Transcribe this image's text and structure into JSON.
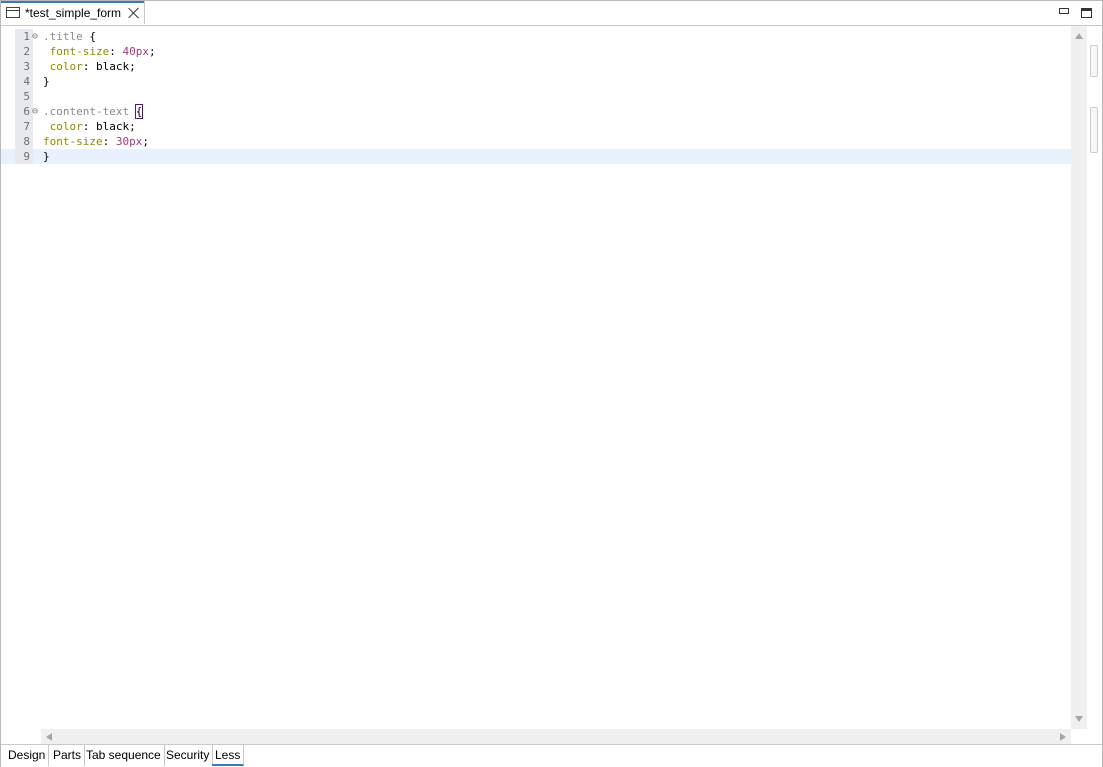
{
  "editor_tab": {
    "title": "*test_simple_form"
  },
  "window_controls": [
    "minimize",
    "maximize"
  ],
  "code": {
    "lines": [
      {
        "n": "1",
        "fold": "⊖",
        "tokens": [
          {
            "t": ".title",
            "c": "sel"
          },
          {
            "t": " {",
            "c": "plain"
          }
        ]
      },
      {
        "n": "2",
        "fold": "",
        "tokens": [
          {
            "t": " font-size",
            "c": "prop"
          },
          {
            "t": ": ",
            "c": "plain"
          },
          {
            "t": "40px",
            "c": "num"
          },
          {
            "t": ";",
            "c": "plain"
          }
        ]
      },
      {
        "n": "3",
        "fold": "",
        "tokens": [
          {
            "t": " color",
            "c": "prop"
          },
          {
            "t": ": black;",
            "c": "plain"
          }
        ]
      },
      {
        "n": "4",
        "fold": "",
        "tokens": [
          {
            "t": "}",
            "c": "plain"
          }
        ]
      },
      {
        "n": "5",
        "fold": "",
        "tokens": []
      },
      {
        "n": "6",
        "fold": "⊖",
        "tokens": [
          {
            "t": ".content-text",
            "c": "sel"
          },
          {
            "t": " ",
            "c": "plain"
          },
          {
            "t": "{",
            "c": "plain",
            "box": true
          }
        ]
      },
      {
        "n": "7",
        "fold": "",
        "tokens": [
          {
            "t": " color",
            "c": "prop"
          },
          {
            "t": ": black;",
            "c": "plain"
          }
        ]
      },
      {
        "n": "8",
        "fold": "",
        "tokens": [
          {
            "t": "font-size",
            "c": "prop"
          },
          {
            "t": ": ",
            "c": "plain"
          },
          {
            "t": "30px",
            "c": "num"
          },
          {
            "t": ";",
            "c": "plain"
          }
        ]
      },
      {
        "n": "9",
        "fold": "",
        "tokens": [
          {
            "t": "}",
            "c": "plain"
          }
        ],
        "current": true
      }
    ]
  },
  "page_tabs": {
    "items": [
      {
        "label": "Design"
      },
      {
        "label": "Parts"
      },
      {
        "label": "Tab sequence"
      },
      {
        "label": "Security"
      },
      {
        "label": "Less",
        "active": true
      }
    ]
  },
  "colors": {
    "accent": "#3b78c0",
    "current_line": "#e8f2fe",
    "selector": "#8a8a8a",
    "property": "#8c8c00",
    "number": "#a33a7c"
  }
}
